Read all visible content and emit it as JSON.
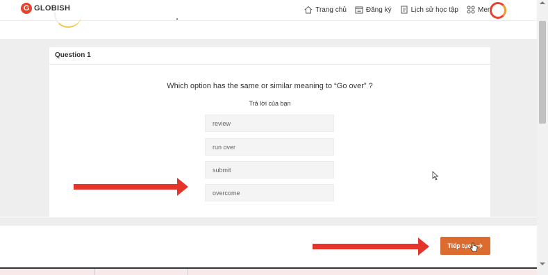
{
  "header": {
    "logo_text": "GLOBISH",
    "nav": [
      {
        "label": "Trang chủ",
        "icon": "home-icon"
      },
      {
        "label": "Đăng ký",
        "icon": "calendar-icon"
      },
      {
        "label": "Lịch sử học tập",
        "icon": "document-icon"
      },
      {
        "label": "Menu",
        "icon": "grid-icon"
      }
    ]
  },
  "quiz": {
    "title": "Question 1",
    "question": "Which option has the same or similar meaning to “Go over” ?",
    "answer_label": "Trả lời của bạn",
    "options": [
      "review",
      "run over",
      "submit",
      "overcome"
    ]
  },
  "footer": {
    "continue_label": "Tiếp tục"
  },
  "colors": {
    "brand": "#e8412c",
    "button": "#dc6b2f",
    "annotation_arrow": "#e5342a"
  }
}
